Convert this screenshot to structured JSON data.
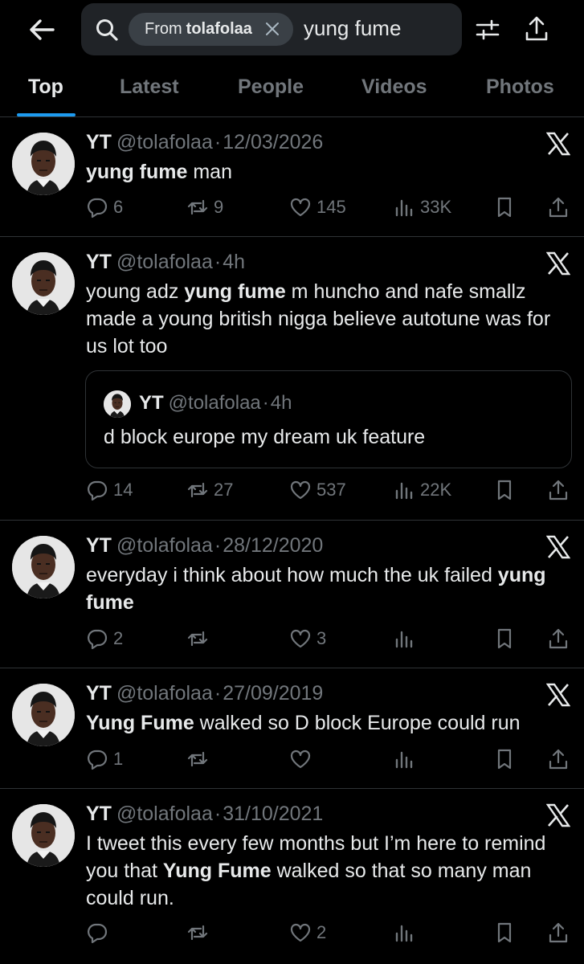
{
  "search": {
    "chip_from": "From",
    "chip_user": "tolafolaa",
    "query": "yung fume"
  },
  "tabs": [
    "Top",
    "Latest",
    "People",
    "Videos",
    "Photos"
  ],
  "tweets": [
    {
      "name": "YT",
      "handle": "@tolafolaa",
      "time": "12/03/2026",
      "text_parts": [
        {
          "t": "yung fume",
          "b": true
        },
        {
          "t": " man",
          "b": false
        }
      ],
      "replies": "6",
      "retweets": "9",
      "likes": "145",
      "views": "33K"
    },
    {
      "name": "YT",
      "handle": "@tolafolaa",
      "time": "4h",
      "text_parts": [
        {
          "t": "young adz ",
          "b": false
        },
        {
          "t": "yung fume",
          "b": true
        },
        {
          "t": " m huncho and nafe smallz made a young british nigga believe autotune was for us lot too",
          "b": false
        }
      ],
      "quote": {
        "name": "YT",
        "handle": "@tolafolaa",
        "time": "4h",
        "text": "d block europe my dream uk feature"
      },
      "replies": "14",
      "retweets": "27",
      "likes": "537",
      "views": "22K"
    },
    {
      "name": "YT",
      "handle": "@tolafolaa",
      "time": "28/12/2020",
      "text_parts": [
        {
          "t": "everyday i think about how much the uk failed ",
          "b": false
        },
        {
          "t": "yung fume",
          "b": true
        }
      ],
      "replies": "2",
      "retweets": "",
      "likes": "3",
      "views": ""
    },
    {
      "name": "YT",
      "handle": "@tolafolaa",
      "time": "27/09/2019",
      "text_parts": [
        {
          "t": "Yung Fume",
          "b": true
        },
        {
          "t": " walked so D block Europe could run",
          "b": false
        }
      ],
      "replies": "1",
      "retweets": "",
      "likes": "",
      "views": ""
    },
    {
      "name": "YT",
      "handle": "@tolafolaa",
      "time": "31/10/2021",
      "text_parts": [
        {
          "t": "I tweet this every few months but I’m here to remind you that ",
          "b": false
        },
        {
          "t": "Yung Fume",
          "b": true
        },
        {
          "t": " walked so that so many man could run.",
          "b": false
        }
      ],
      "replies": "",
      "retweets": "",
      "likes": "2",
      "views": ""
    }
  ],
  "colors": {
    "background": "#000000",
    "text": "#e7e9ea",
    "muted": "#71767b",
    "accent": "#1d9bf0",
    "divider": "#2f3336",
    "search_bg": "#202327"
  },
  "icons": [
    "back-arrow-icon",
    "search-icon",
    "close-icon",
    "filter-icon",
    "share-icon",
    "x-logo-icon",
    "reply-icon",
    "retweet-icon",
    "like-icon",
    "views-icon",
    "bookmark-icon"
  ]
}
